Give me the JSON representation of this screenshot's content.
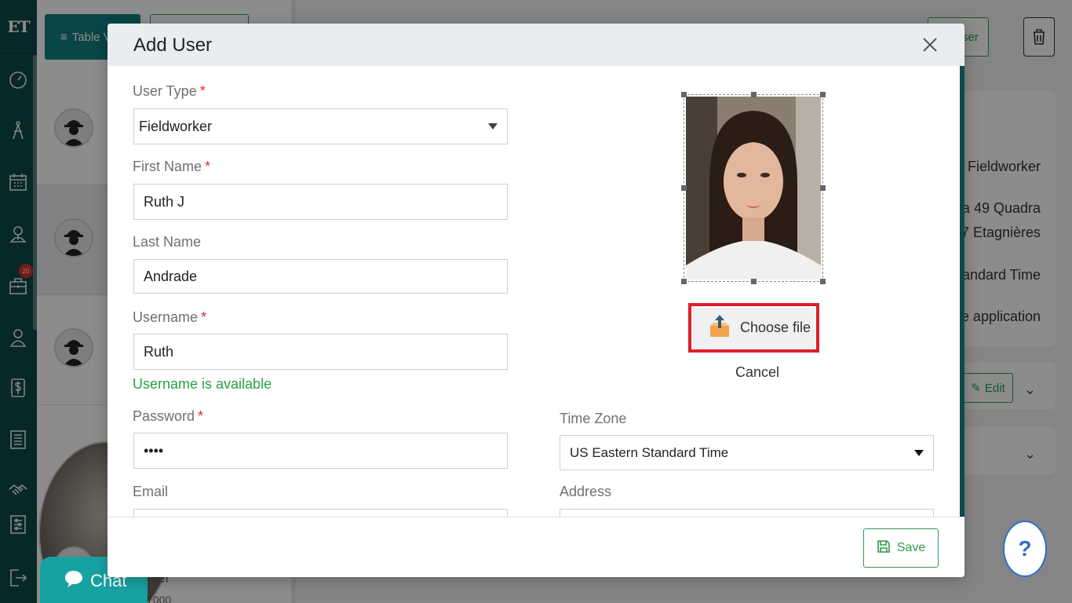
{
  "app": {
    "logo": "ET",
    "notification_count": "20"
  },
  "background": {
    "table_view_label": "Table V",
    "edit_user_label": "dit User",
    "user_type": "Fieldworker",
    "address_line1": "dra 49 Quadra",
    "address_line2": "037 Etagnières",
    "timezone": "Standard Time",
    "app_access": "bile application",
    "edit_label": "Edit",
    "partial_text1": "rker",
    "partial_text2": "7000"
  },
  "chat": {
    "label": "Chat"
  },
  "help": {
    "label": "?"
  },
  "modal": {
    "title": "Add User",
    "fields": {
      "user_type": {
        "label": "User Type",
        "required": "*",
        "value": "Fieldworker"
      },
      "first_name": {
        "label": "First Name",
        "required": "*",
        "value": "Ruth J"
      },
      "last_name": {
        "label": "Last Name",
        "value": "Andrade"
      },
      "username": {
        "label": "Username",
        "required": "*",
        "value": "Ruth",
        "status": "Username is available"
      },
      "password": {
        "label": "Password",
        "required": "*",
        "value": "••••"
      },
      "email": {
        "label": "Email",
        "value": ""
      },
      "time_zone": {
        "label": "Time Zone",
        "value": "US Eastern Standard Time"
      },
      "address": {
        "label": "Address",
        "value": ""
      }
    },
    "photo": {
      "choose_label": "Choose file",
      "cancel_label": "Cancel"
    },
    "footer": {
      "save_label": "Save"
    }
  },
  "colors": {
    "nav": "#0d4a4a",
    "accent": "#138080",
    "success": "#2aa046",
    "required": "#d9302c",
    "highlight": "#e01d2a"
  }
}
